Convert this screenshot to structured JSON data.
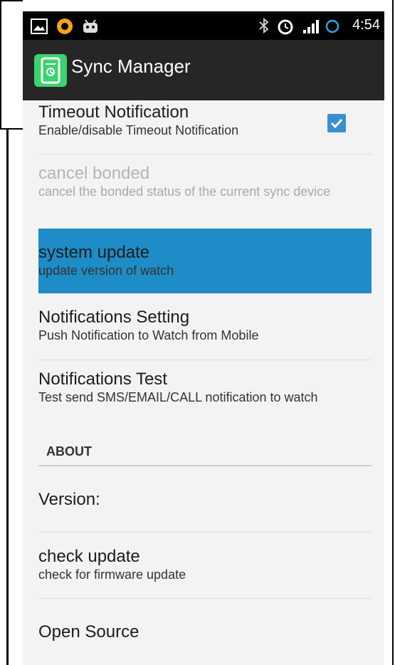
{
  "status_bar": {
    "time": "4:54",
    "left_icons": [
      "image-icon",
      "cyanogen-icon",
      "android-icon"
    ],
    "right_icons": [
      "bluetooth-icon",
      "alarm-icon",
      "signal-icon",
      "sync-circle-icon"
    ]
  },
  "action_bar": {
    "title": "Sync Manager",
    "icon": "watch-app-icon",
    "accent": "#3ad36c"
  },
  "settings": [
    {
      "title": "Timeout Notification",
      "summary": "Enable/disable Timeout Notification",
      "checked": true
    },
    {
      "title": "cancel bonded",
      "summary": "cancel the bonded status of the current sync device",
      "enabled": false
    },
    {
      "title": "system update",
      "summary": "update version of watch",
      "highlighted": true
    },
    {
      "title": "Notifications Setting",
      "summary": "Push Notification to Watch from Mobile"
    },
    {
      "title": "Notifications Test",
      "summary": "Test send SMS/EMAIL/CALL notification to watch"
    }
  ],
  "about": {
    "header": "ABOUT",
    "items": [
      {
        "title": "Version:",
        "summary": ""
      },
      {
        "title": "check update",
        "summary": "check for firmware update"
      },
      {
        "title": "Open Source",
        "summary": ""
      }
    ]
  },
  "colors": {
    "highlight": "#1e8cc6",
    "checkbox": "#3a90cf",
    "action_bar_bg": "#262626"
  }
}
